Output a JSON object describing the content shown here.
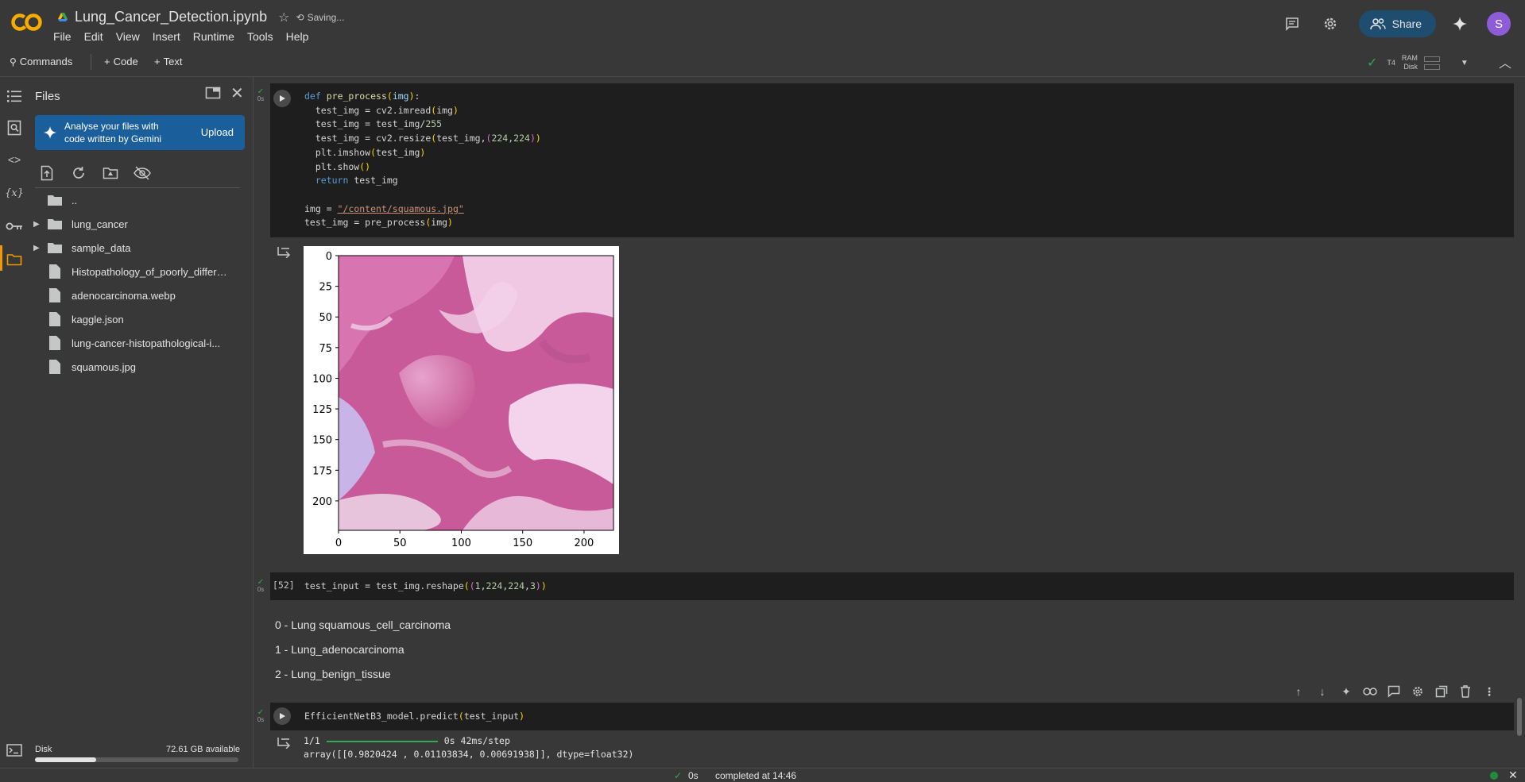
{
  "header": {
    "notebook_title": "Lung_Cancer_Detection.ipynb",
    "saving_text": "Saving...",
    "menu": [
      "File",
      "Edit",
      "View",
      "Insert",
      "Runtime",
      "Tools",
      "Help"
    ],
    "share_label": "Share",
    "avatar_letter": "S",
    "brand_colors": {
      "logo_orange": "#f9ab00",
      "share_bg": "#1f4d70",
      "avatar_bg": "#8e5cd9"
    }
  },
  "toolbar": {
    "commands_label": "Commands",
    "add_code_label": "Code",
    "add_text_label": "Text",
    "runtime_type": "T4",
    "ram_label": "RAM",
    "disk_label": "Disk"
  },
  "files_panel": {
    "title": "Files",
    "gemini_banner_text": "Analyse your files with code written by Gemini",
    "upload_label": "Upload",
    "items": [
      {
        "name": "..",
        "type": "folder",
        "expandable": false
      },
      {
        "name": "lung_cancer",
        "type": "folder",
        "expandable": true
      },
      {
        "name": "sample_data",
        "type": "folder",
        "expandable": true
      },
      {
        "name": "Histopathology_of_poorly_differe...",
        "type": "file",
        "expandable": false
      },
      {
        "name": "adenocarcinoma.webp",
        "type": "file",
        "expandable": false
      },
      {
        "name": "kaggle.json",
        "type": "file",
        "expandable": false
      },
      {
        "name": "lung-cancer-histopathological-i...",
        "type": "file",
        "expandable": false
      },
      {
        "name": "squamous.jpg",
        "type": "file",
        "expandable": false
      }
    ],
    "disk_label": "Disk",
    "disk_available": "72.61 GB available",
    "disk_used_fraction": 0.3
  },
  "cells": {
    "cell1": {
      "status_time": "0s",
      "code_lines": [
        "def pre_process(img):",
        "  test_img = cv2.imread(img)",
        "  test_img = test_img/255",
        "  test_img = cv2.resize(test_img,(224,224))",
        "  plt.imshow(test_img)",
        "  plt.show()",
        "  return test_img",
        "",
        "img = \"/content/squamous.jpg\"",
        "test_img = pre_process(img)"
      ],
      "plot": {
        "x_ticks": [
          "0",
          "50",
          "100",
          "150",
          "200"
        ],
        "y_ticks": [
          "0",
          "25",
          "50",
          "75",
          "100",
          "125",
          "150",
          "175",
          "200"
        ]
      }
    },
    "cell2": {
      "status_time": "0s",
      "exec_count": "[52]",
      "code": "test_input = test_img.reshape((1,224,224,3))"
    },
    "markdown": [
      "0 - Lung squamous_cell_carcinoma",
      "1 - Lung_adenocarcinoma",
      "2 - Lung_benign_tissue"
    ],
    "cell3": {
      "status_time": "0s",
      "code": "EfficientNetB3_model.predict(test_input)",
      "progress_text": "1/1",
      "progress_stats": "0s 42ms/step",
      "output_array": "array([[0.9820424 , 0.01103834, 0.00691938]], dtype=float32)"
    }
  },
  "status_bar": {
    "check_time": "0s",
    "completed_text": "completed at 14:46"
  }
}
